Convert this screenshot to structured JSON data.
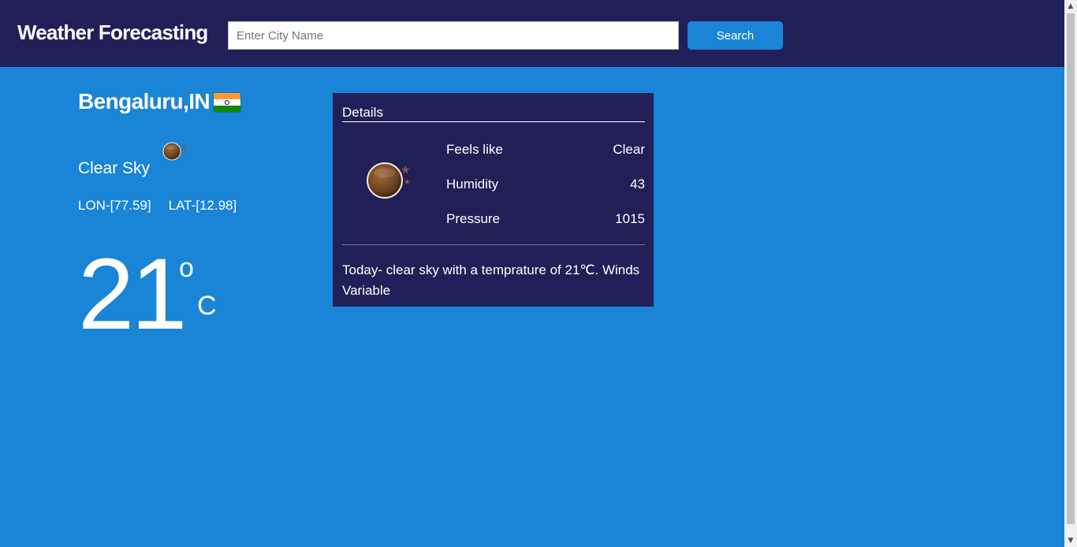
{
  "header": {
    "brand": "Weather Forecasting",
    "search_placeholder": "Enter City Name",
    "search_value": "",
    "search_button": "Search"
  },
  "location": {
    "city": "Bengaluru,IN",
    "flag_icon": "india-flag-icon",
    "condition": "Clear Sky",
    "condition_icon": "moon-icon",
    "lon": "LON-[77.59]",
    "lat": "LAT-[12.98]"
  },
  "temperature": {
    "value": "21",
    "degree_symbol": "o",
    "unit": "C"
  },
  "details": {
    "title": "Details",
    "icon": "moon-icon",
    "rows": [
      {
        "label": "Feels like",
        "value": "Clear"
      },
      {
        "label": "Humidity",
        "value": "43"
      },
      {
        "label": "Pressure",
        "value": "1015"
      }
    ],
    "summary": "Today- clear sky with a temprature of 21℃. Winds Variable"
  },
  "colors": {
    "navbar": "#211f58",
    "background": "#1a84d7",
    "card": "#211f58",
    "button": "#1a84d7",
    "text": "#ffffff"
  }
}
